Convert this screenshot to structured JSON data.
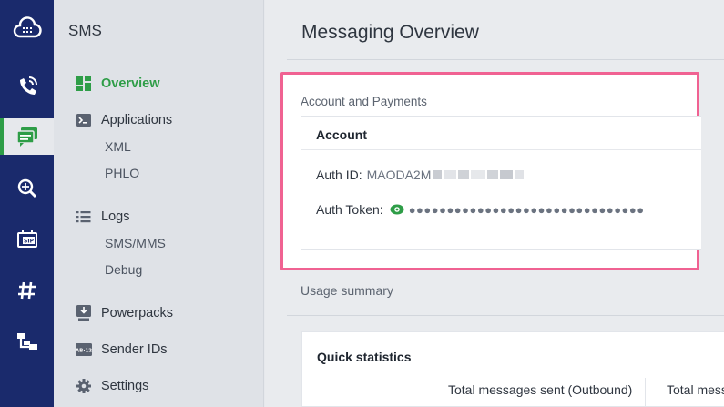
{
  "rail": {
    "items": [
      {
        "icon": "cloud-grid-icon"
      },
      {
        "icon": "voice-call-icon"
      },
      {
        "icon": "sms-messages-icon",
        "active": true
      },
      {
        "icon": "number-lookup-icon"
      },
      {
        "icon": "sip-icon"
      },
      {
        "icon": "phone-numbers-hash-icon"
      },
      {
        "icon": "flow-diagram-icon"
      }
    ],
    "colors": {
      "background": "#1a2a6c",
      "active_accent": "#2e9d47"
    }
  },
  "sidenav": {
    "title": "SMS",
    "items": [
      {
        "label": "Overview",
        "icon": "dashboard-grid-icon",
        "active": true
      },
      {
        "label": "Applications",
        "icon": "terminal-icon",
        "children": [
          "XML",
          "PHLO"
        ]
      },
      {
        "label": "Logs",
        "icon": "list-icon",
        "children": [
          "SMS/MMS",
          "Debug"
        ]
      },
      {
        "label": "Powerpacks",
        "icon": "inbox-download-icon"
      },
      {
        "label": "Sender IDs",
        "icon": "sender-id-icon"
      },
      {
        "label": "Settings",
        "icon": "gear-icon"
      }
    ]
  },
  "main": {
    "title": "Messaging Overview",
    "account_section": {
      "label": "Account and Payments",
      "card_title": "Account",
      "auth_id_label": "Auth ID:",
      "auth_id_value": "MAODA2M",
      "auth_token_label": "Auth Token:",
      "auth_token_value": "●●●●●●●●●●●●●●●●●●●●●●●●●●●●●●●"
    },
    "usage": {
      "label": "Usage summary",
      "quick_stats_title": "Quick statistics",
      "columns": [
        "Total messages sent (Outbound)",
        "Total messa"
      ]
    }
  },
  "colors": {
    "accent": "#2e9d47",
    "highlight": "#f06292"
  }
}
